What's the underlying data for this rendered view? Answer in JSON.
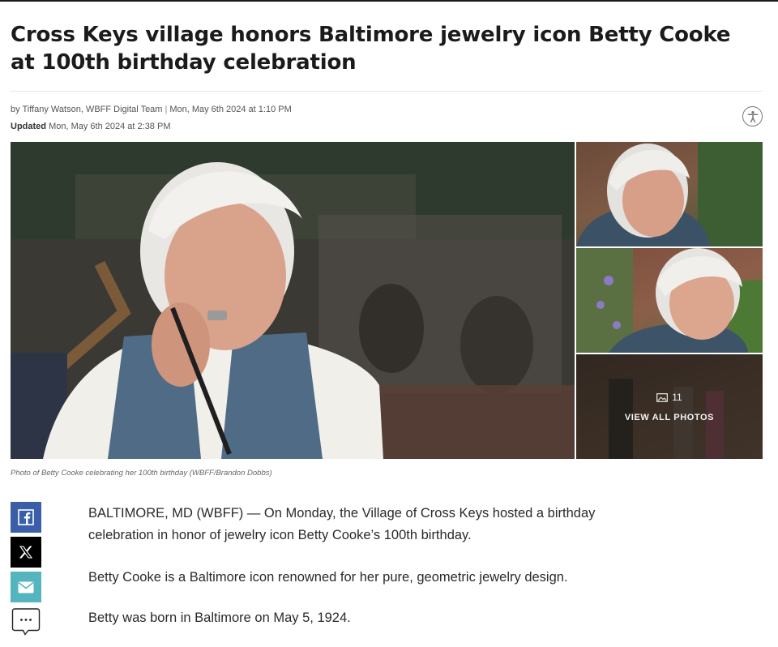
{
  "article": {
    "headline": "Cross Keys village honors Baltimore jewelry icon Betty Cooke at 100th birthday celebration",
    "byline": "by Tiffany Watson, WBFF Digital Team",
    "published": "Mon, May 6th 2024 at 1:10 PM",
    "updated_label": "Updated",
    "updated": "Mon, May 6th 2024 at 2:38 PM",
    "caption": "Photo of Betty Cooke celebrating her 100th birthday (WBFF/Brandon Dobbs)",
    "paragraphs": [
      "BALTIMORE, MD (WBFF) — On Monday, the Village of Cross Keys hosted a birthday celebration in honor of jewelry icon Betty Cooke’s 100th birthday.",
      "Betty Cooke is a Baltimore icon renowned for her pure, geometric jewelry design.",
      "Betty was born in Baltimore on May 5, 1924."
    ]
  },
  "gallery": {
    "photo_count": "11",
    "view_all_label": "VIEW ALL PHOTOS"
  },
  "share": {
    "icons": [
      "facebook-icon",
      "x-icon",
      "email-icon",
      "more-icon"
    ]
  },
  "colors": {
    "facebook": "#3b5ea8",
    "x": "#000000",
    "email": "#55b5bf"
  }
}
